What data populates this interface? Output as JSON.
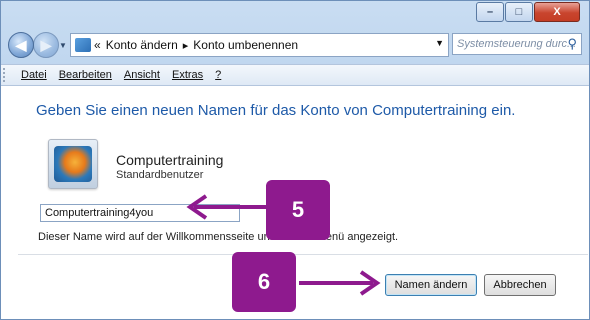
{
  "window": {
    "caption_buttons": {
      "minimize": "–",
      "maximize": "□",
      "close": "X"
    }
  },
  "nav": {
    "back_icon": "back-arrow-icon",
    "forward_icon": "forward-arrow-icon",
    "address_prefix": "«",
    "crumbs": [
      "Konto ändern",
      "Konto umbenennen"
    ],
    "crumb_separator": "▸",
    "search_placeholder": "Systemsteuerung durc..."
  },
  "menu": {
    "items": [
      "Datei",
      "Bearbeiten",
      "Ansicht",
      "Extras",
      "?"
    ]
  },
  "main": {
    "heading": "Geben Sie einen neuen Namen für das Konto von Computertraining ein.",
    "account_name": "Computertraining",
    "account_role": "Standardbenutzer",
    "new_name_value": "Computertraining4you",
    "hint": "Dieser Name wird auf der Willkommensseite und im Startmenü angezeigt.",
    "primary_button": "Namen ändern",
    "cancel_button": "Abbrechen"
  },
  "annotations": {
    "step_a": "5",
    "step_b": "6",
    "badge_color": "#8e1a8e"
  }
}
